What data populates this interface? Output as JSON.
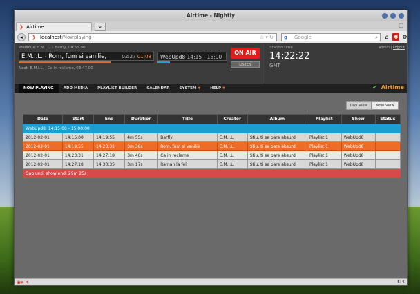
{
  "window": {
    "title": "Airtime - Nightly"
  },
  "browser": {
    "tab_title": "Airtime",
    "url_host": "localhost",
    "url_path": "/Nowplaying",
    "search_placeholder": "Google"
  },
  "player": {
    "previous_label": "Previous:",
    "previous_track": "E.M.I.L. - Barfly, 04:55.00",
    "now_artist": "E.M.I.L.",
    "now_separator": "-",
    "now_title": "Rom, fum si vanilie,",
    "elapsed": "02:27",
    "remaining": "01:08",
    "track_progress": 0.68,
    "show_name": "WebUpd8",
    "show_time": "14:15 - 15:00",
    "show_progress": 0.18,
    "next_label": "Next:",
    "next_track": "E.M.I.L. - Ca in reclame, 03:47.00",
    "on_air_label": "ON AIR",
    "listen_label": "LISTEN"
  },
  "station": {
    "label": "Station time",
    "time": "14:22:22",
    "timezone": "GMT",
    "user": "admin",
    "separator": "|",
    "logout": "Logout"
  },
  "menu": {
    "items": [
      "NOW PLAYING",
      "ADD MEDIA",
      "PLAYLIST BUILDER",
      "CALENDAR",
      "SYSTEM",
      "HELP"
    ],
    "logo": "Airtime"
  },
  "view": {
    "day": "Day View",
    "now": "Now View"
  },
  "table": {
    "headers": [
      "Date",
      "Start",
      "End",
      "Duration",
      "Title",
      "Creator",
      "Album",
      "Playlist",
      "Show",
      "Status"
    ],
    "show_header": "WebUpd8: 14:15:00 - 15:00:00",
    "rows": [
      [
        "2012-02-01",
        "14:15:00",
        "14:19:55",
        "4m 55s",
        "Barfly",
        "E.M.I.L.",
        "Stiu, ti se pare absurd",
        "Playlist 1",
        "WebUpd8",
        ""
      ],
      [
        "2012-02-01",
        "14:19:55",
        "14:23:31",
        "3m 36s",
        "Rom, fum si vanilie",
        "E.M.I.L.",
        "Stiu, ti se pare absurd",
        "Playlist 1",
        "WebUpd8",
        ""
      ],
      [
        "2012-02-01",
        "14:23:31",
        "14:27:18",
        "3m 46s",
        "Ca in reclame",
        "E.M.I.L.",
        "Stiu, ti se pare absurd",
        "Playlist 1",
        "WebUpd8",
        ""
      ],
      [
        "2012-02-01",
        "14:27:18",
        "14:30:35",
        "3m 17s",
        "Raman la fel",
        "E.M.I.L.",
        "Stiu, ti se pare absurd",
        "Playlist 1",
        "WebUpd8",
        ""
      ]
    ],
    "gap_text": "Gap until show end: 29m 25s"
  },
  "colors": {
    "accent_orange": "#ec6c28",
    "show_blue": "#1a9fd0",
    "on_air_red": "#e01b1b",
    "gap_red": "#d84a4a"
  }
}
